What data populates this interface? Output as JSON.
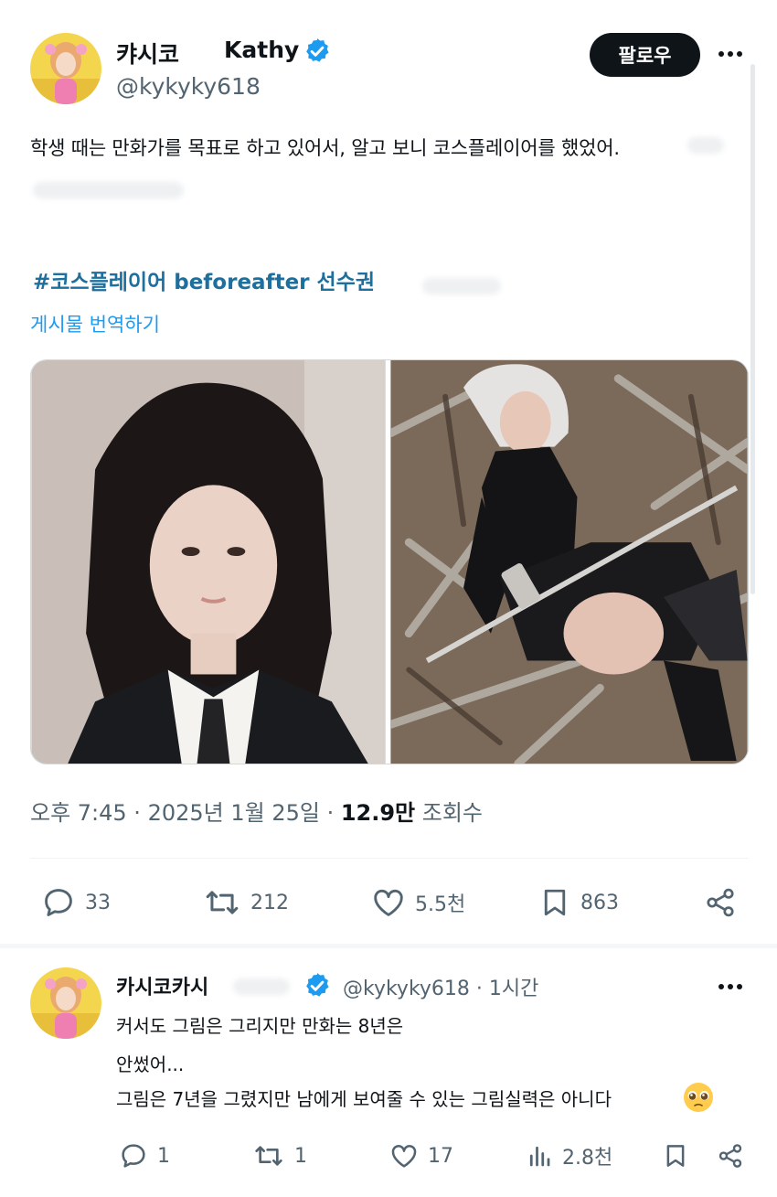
{
  "tweet": {
    "display_name": "캬시코",
    "display_name_latin": "Kathy",
    "handle": "@kykyky618",
    "follow_label": "팔로우",
    "text": "학생 때는 만화가를 목표로 하고 있어서, 알고 보니 코스플레이어를 했었어.",
    "hashtag": "#코스플레이어 beforeafter 선수권",
    "translate_label": "게시물 번역하기",
    "timestamp_prefix": "오후 7:45 · 2025년 1월 25일 · ",
    "views_value": "12.9만",
    "views_label": " 조회수",
    "stats": {
      "replies": "33",
      "retweets": "212",
      "likes": "5.5천",
      "bookmarks": "863"
    }
  },
  "reply": {
    "display_name": "카시코카시",
    "handle_time": "@kykyky618 · 1시간",
    "lines": [
      "커서도 그림은 그리지만 만화는 8년은",
      "안썼어...",
      "그림은 7년을 그렸지만 남에게 보여줄 수 있는 그림실력은 아니다"
    ],
    "emoji": "pleading-face",
    "stats": {
      "replies": "1",
      "retweets": "1",
      "likes": "17",
      "views": "2.8천"
    }
  },
  "colors": {
    "text": "#0f1419",
    "secondary": "#536471",
    "link": "#1d9bf0",
    "hashtag": "#1d6f9e",
    "verified": "#1d9bf0"
  }
}
